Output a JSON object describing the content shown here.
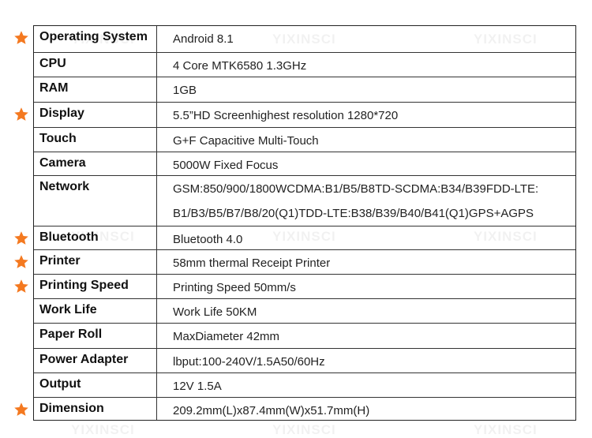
{
  "watermark": "YIXINSCI",
  "star_color": "#f47920",
  "rows": [
    {
      "label": "Operating System",
      "value": "Android 8.1",
      "starred": true
    },
    {
      "label": "CPU",
      "value": "4 Core MTK6580 1.3GHz",
      "starred": false
    },
    {
      "label": "RAM",
      "value": "1GB",
      "starred": false
    },
    {
      "label": "Display",
      "value": "5.5”HD Screenhighest resolution 1280*720",
      "starred": true
    },
    {
      "label": "Touch",
      "value": "G+F Capacitive Multi-Touch",
      "starred": false
    },
    {
      "label": "Camera",
      "value": "5000W Fixed Focus",
      "starred": false
    },
    {
      "label": "Network",
      "value": "GSM:850/900/1800WCDMA:B1/B5/B8TD-SCDMA:B34/B39FDD-LTE: B1/B3/B5/B7/B8/20(Q1)TDD-LTE:B38/B39/B40/B41(Q1)GPS+AGPS",
      "starred": false
    },
    {
      "label": "Bluetooth",
      "value": "Bluetooth 4.0",
      "starred": true
    },
    {
      "label": "Printer",
      "value": "58mm thermal Receipt Printer",
      "starred": true
    },
    {
      "label": "Printing Speed",
      "value": "Printing Speed 50mm/s",
      "starred": true
    },
    {
      "label": "Work Life",
      "value": "Work Life 50KM",
      "starred": false
    },
    {
      "label": "Paper Roll",
      "value": "MaxDiameter 42mm",
      "starred": false
    },
    {
      "label": "Power Adapter",
      "value": "lbput:100-240V/1.5A50/60Hz",
      "starred": false
    },
    {
      "label": "Output",
      "value": "12V 1.5A",
      "starred": false
    },
    {
      "label": "Dimension",
      "value": "209.2mm(L)x87.4mm(W)x51.7mm(H)",
      "starred": true
    }
  ]
}
